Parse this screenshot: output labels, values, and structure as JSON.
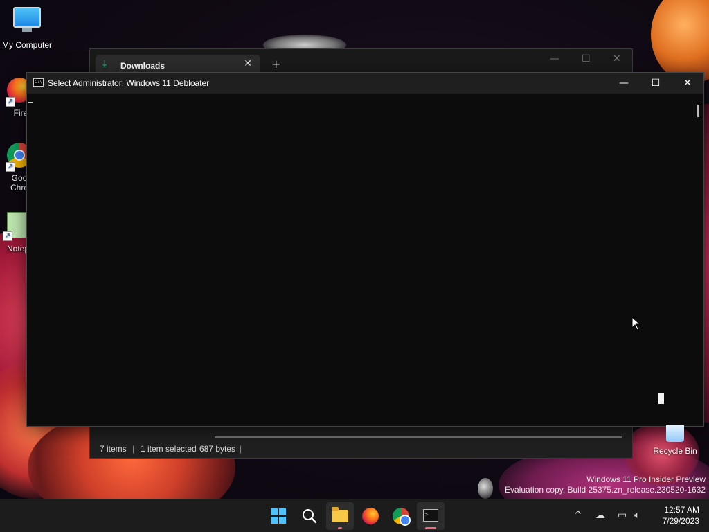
{
  "desktop": {
    "icons": [
      {
        "label": "My Computer"
      },
      {
        "label": "Fire"
      },
      {
        "label": "Goo Chro"
      },
      {
        "label": "Notep"
      }
    ],
    "recycle_bin_label": "Recycle Bin"
  },
  "explorer": {
    "tab_label": "Downloads",
    "status": {
      "items": "7 items",
      "selected": "1 item selected",
      "size": "687 bytes"
    }
  },
  "console": {
    "title": "Select Administrator:  Windows 11 Debloater",
    "icon_text": "C:\\_"
  },
  "watermark": {
    "line1": "Windows 11 Pro Insider Preview",
    "line2": "Evaluation copy. Build 25375.zn_release.230520-1632"
  },
  "taskbar": {
    "apps": [
      "start",
      "search",
      "file-explorer",
      "firefox",
      "chrome",
      "terminal"
    ],
    "time": "12:57 AM",
    "date": "7/29/2023"
  },
  "colors": {
    "accent": "#4cc2ff",
    "running_indicator": "#f06a7a",
    "download_green": "#2ec27e"
  }
}
